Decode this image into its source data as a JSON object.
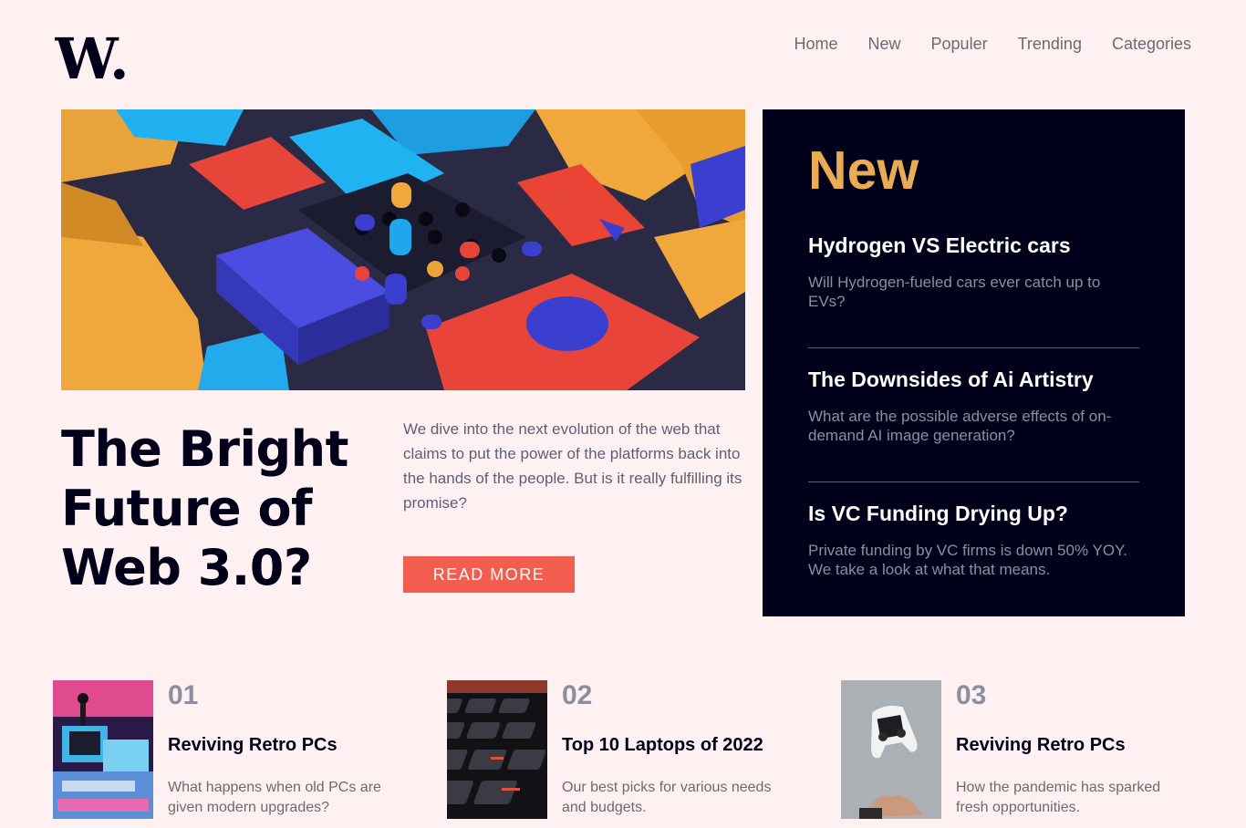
{
  "brand": {
    "logo": "W."
  },
  "nav": {
    "items": [
      "Home",
      "New",
      "Populer",
      "Trending",
      "Categories"
    ]
  },
  "hero": {
    "title": "The Bright Future of Web 3.0?",
    "description": "We dive into the next evolution of the web that claims to put the power of the platforms back into the hands of the people. But is it really fulfilling its promise?",
    "button": "READ MORE"
  },
  "sidebar": {
    "title": "New",
    "items": [
      {
        "title": "Hydrogen VS Electric cars",
        "desc": "Will Hydrogen-fueled cars ever catch up to EVs?"
      },
      {
        "title": "The Downsides of Ai Artistry",
        "desc": "What are the possible adverse effects of on-demand AI image generation?"
      },
      {
        "title": "Is VC Funding Drying Up?",
        "desc": "Private funding by VC firms is down 50% YOY. We take a look at what that means."
      }
    ]
  },
  "articles": [
    {
      "num": "01",
      "title": "Reviving Retro PCs",
      "desc": "What happens when old PCs are given modern upgrades?"
    },
    {
      "num": "02",
      "title": "Top 10 Laptops of 2022",
      "desc": "Our best picks for various needs and budgets."
    },
    {
      "num": "03",
      "title": "Reviving Retro PCs",
      "desc": "How the pandemic has sparked fresh opportunities."
    }
  ],
  "colors": {
    "background": "#fff1f1",
    "dark": "#00001a",
    "accent_orange": "#e9ab53",
    "accent_red": "#f15e50",
    "muted": "#5d5f79"
  }
}
